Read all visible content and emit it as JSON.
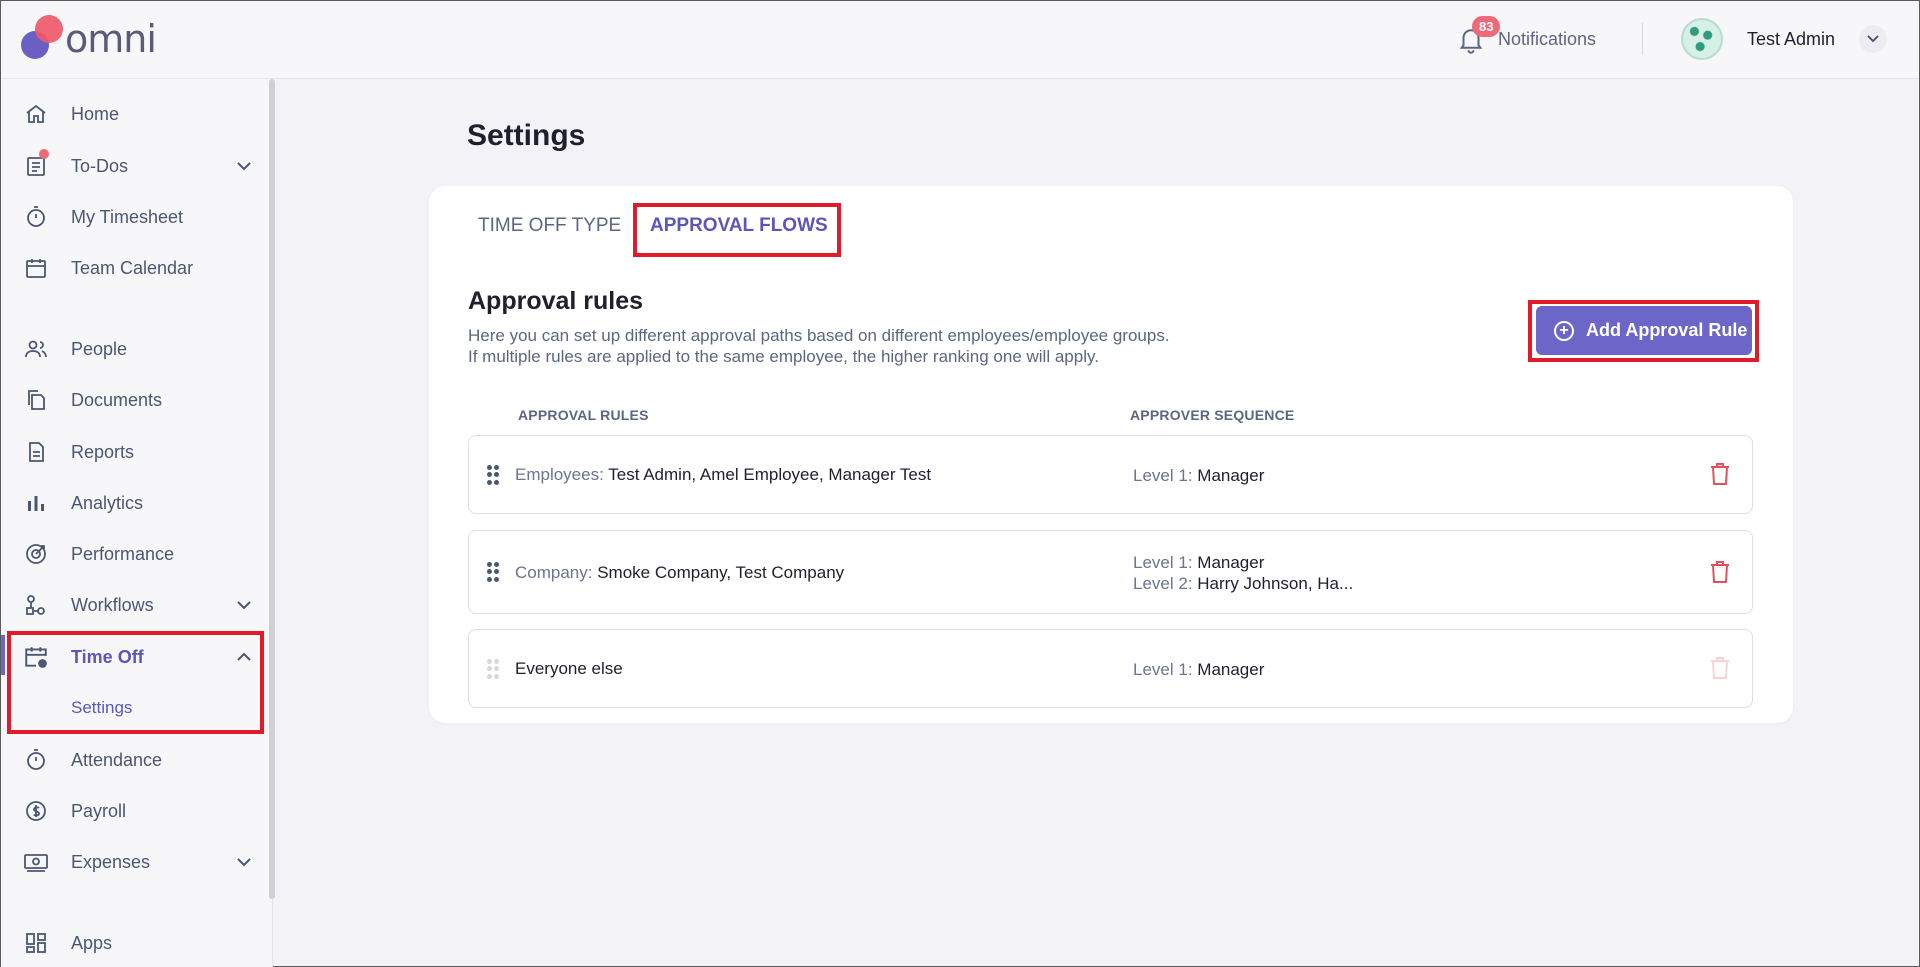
{
  "header": {
    "logo_text": "omni",
    "notifications_label": "Notifications",
    "notifications_count": "83",
    "user_name": "Test Admin"
  },
  "sidebar": {
    "items": [
      {
        "label": "Home",
        "icon": "home-icon"
      },
      {
        "label": "To-Dos",
        "icon": "todo-list-icon"
      },
      {
        "label": "My Timesheet",
        "icon": "stopwatch-icon"
      },
      {
        "label": "Team Calendar",
        "icon": "calendar-icon"
      },
      {
        "label": "People",
        "icon": "people-icon"
      },
      {
        "label": "Documents",
        "icon": "documents-icon"
      },
      {
        "label": "Reports",
        "icon": "report-icon"
      },
      {
        "label": "Analytics",
        "icon": "bar-chart-icon"
      },
      {
        "label": "Performance",
        "icon": "target-icon"
      },
      {
        "label": "Workflows",
        "icon": "workflow-icon"
      },
      {
        "label": "Time Off",
        "icon": "calendar-clock-icon"
      },
      {
        "label": "Attendance",
        "icon": "stopwatch-icon"
      },
      {
        "label": "Payroll",
        "icon": "dollar-circle-icon"
      },
      {
        "label": "Expenses",
        "icon": "money-icon"
      },
      {
        "label": "Apps",
        "icon": "apps-grid-icon"
      }
    ],
    "time_off_sub": "Settings"
  },
  "main": {
    "page_title": "Settings",
    "tabs": [
      {
        "label": "TIME OFF TYPE"
      },
      {
        "label": "APPROVAL FLOWS"
      }
    ],
    "section_title": "Approval rules",
    "description_line1": "Here you can set up different approval paths based on different employees/employee groups.",
    "description_line2": "If multiple rules are applied to the same employee, the higher ranking one will apply.",
    "add_button_label": "Add Approval Rule",
    "columns": {
      "rules": "APPROVAL RULES",
      "sequence": "APPROVER SEQUENCE"
    },
    "rules": [
      {
        "key": "Employees:",
        "value": "Test Admin, Amel Employee, Manager Test",
        "levels": [
          {
            "key": "Level 1:",
            "value": "Manager"
          }
        ]
      },
      {
        "key": "Company:",
        "value": "Smoke Company, Test Company",
        "levels": [
          {
            "key": "Level 1:",
            "value": "Manager"
          },
          {
            "key": "Level 2:",
            "value": "Harry Johnson, Ha..."
          }
        ]
      },
      {
        "key": "",
        "value": "Everyone else",
        "levels": [
          {
            "key": "Level 1:",
            "value": "Manager"
          }
        ]
      }
    ]
  },
  "colors": {
    "accent": "#6b66c8",
    "highlight": "#e01b2a",
    "delete": "#e2505c"
  }
}
